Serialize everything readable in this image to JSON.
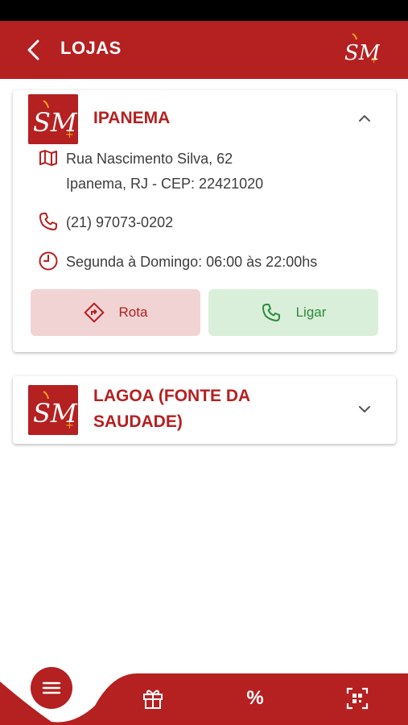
{
  "header": {
    "title": "LOJAS",
    "back_icon": "chevron-left-icon",
    "logo_text": "SM"
  },
  "stores": [
    {
      "name": "IPANEMA",
      "logo_text": "SM",
      "expanded": true,
      "address_line1": "Rua Nascimento Silva, 62",
      "address_line2": "Ipanema, RJ - CEP:  22421020",
      "phone": "(21) 97073-0202",
      "hours": "Segunda à Domingo: 06:00 às 22:00hs",
      "route_label": "Rota",
      "call_label": "Ligar"
    },
    {
      "name": "LAGOA (FONTE DA SAUDADE)",
      "logo_text": "SM",
      "expanded": false
    }
  ],
  "bottom_nav": {
    "menu_icon": "hamburger-menu-icon",
    "items": [
      {
        "icon": "gift-icon"
      },
      {
        "icon": "percent-icon",
        "label": "%"
      },
      {
        "icon": "qr-code-scan-icon"
      }
    ]
  },
  "colors": {
    "brand_red": "#b52021",
    "route_bg": "#f2d3d3",
    "call_bg": "#d9efd9",
    "call_green": "#2e8b3d"
  }
}
